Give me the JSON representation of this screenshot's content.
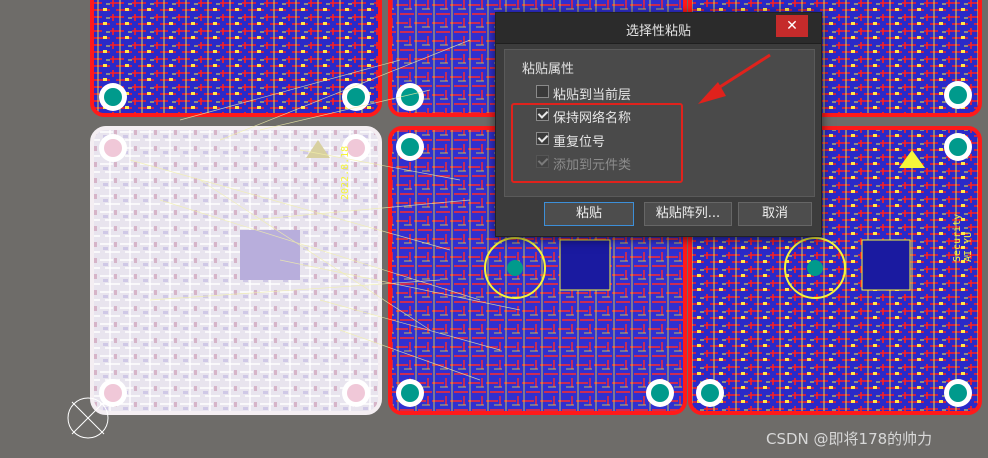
{
  "dialog": {
    "title": "选择性粘贴",
    "close_glyph": "✕",
    "group_label": "粘贴属性",
    "options": [
      {
        "label": "粘贴到当前层",
        "checked": false,
        "enabled": true
      },
      {
        "label": "保持网络名称",
        "checked": true,
        "enabled": true
      },
      {
        "label": "重复位号",
        "checked": true,
        "enabled": true
      },
      {
        "label": "添加到元件类",
        "checked": true,
        "enabled": false
      }
    ],
    "buttons": {
      "paste": "粘贴",
      "paste_array": "粘贴阵列...",
      "cancel": "取消"
    }
  },
  "watermark": "CSDN @即将178的帅力",
  "boards": [
    {
      "date": "2022.8.18",
      "name": "Security AI YU"
    }
  ],
  "colors": {
    "board_bg": "#2a2ac8",
    "copper_red": "#ff1a1a",
    "silk_yellow": "#f5f53a",
    "pad_teal": "#009a8c",
    "background": "#6e6c69",
    "highlight_red": "#e0221c",
    "dialog_bg": "#3c3c3c"
  },
  "icons": {
    "close": "close-icon",
    "arrow": "red-arrow-annotation",
    "origin": "origin-marker-icon"
  }
}
